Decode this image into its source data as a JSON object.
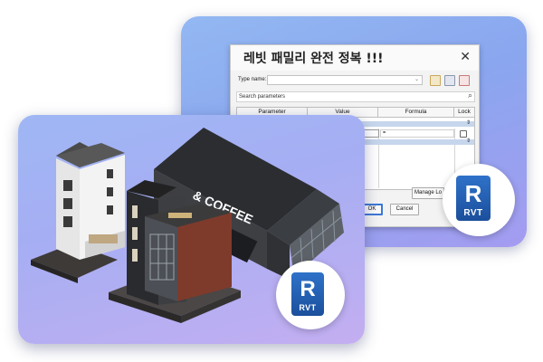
{
  "dialog": {
    "title": "레빗 패밀리 완전 정복 !!!",
    "close_glyph": "✕",
    "type_name_label": "Type name:",
    "search_placeholder": "Search parameters",
    "columns": [
      "Parameter",
      "Value",
      "Formula",
      "Lock"
    ],
    "formula_cell": "=",
    "manage_button": "Manage Lo",
    "ok_button": "OK",
    "cancel_button": "Cancel",
    "colors": {
      "band": "#c6d6ec",
      "ok_border": "#3b78d6"
    }
  },
  "building": {
    "sign_text": "& COFFEE"
  },
  "badge_back": {
    "letter": "R",
    "label": "RVT"
  },
  "badge_front": {
    "letter": "R",
    "label": "RVT"
  },
  "colors": {
    "card_back": "#8aa6ef",
    "card_front": "#a6aef3",
    "brand_blue": "#1f5fb8"
  }
}
